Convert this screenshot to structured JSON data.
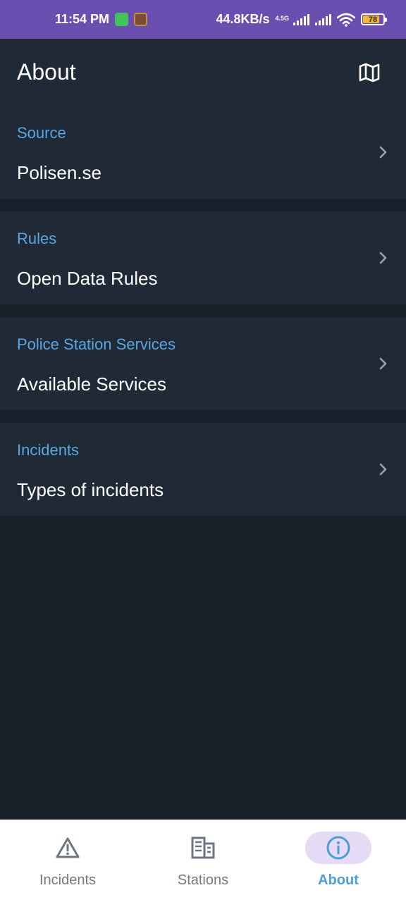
{
  "status_bar": {
    "time": "11:54 PM",
    "net_speed": "44.8KB/s",
    "network_gen": "4.5G",
    "battery": "78"
  },
  "app_bar": {
    "title": "About",
    "map_icon": "map-icon"
  },
  "sections": [
    {
      "label": "Source",
      "value": "Polisen.se"
    },
    {
      "label": "Rules",
      "value": "Open Data Rules"
    },
    {
      "label": "Police Station Services",
      "value": "Available Services"
    },
    {
      "label": "Incidents",
      "value": "Types of incidents"
    }
  ],
  "bottom_nav": {
    "items": [
      {
        "label": "Incidents",
        "icon": "warning-icon",
        "active": false
      },
      {
        "label": "Stations",
        "icon": "building-icon",
        "active": false
      },
      {
        "label": "About",
        "icon": "info-icon",
        "active": true
      }
    ]
  },
  "colors": {
    "status_bar": "#6a4fb0",
    "background": "#18202a",
    "card": "#202a36",
    "accent_label": "#5aa6e0",
    "nav_active_pill": "#e6dbf5",
    "nav_active_text": "#4a9fd8"
  }
}
